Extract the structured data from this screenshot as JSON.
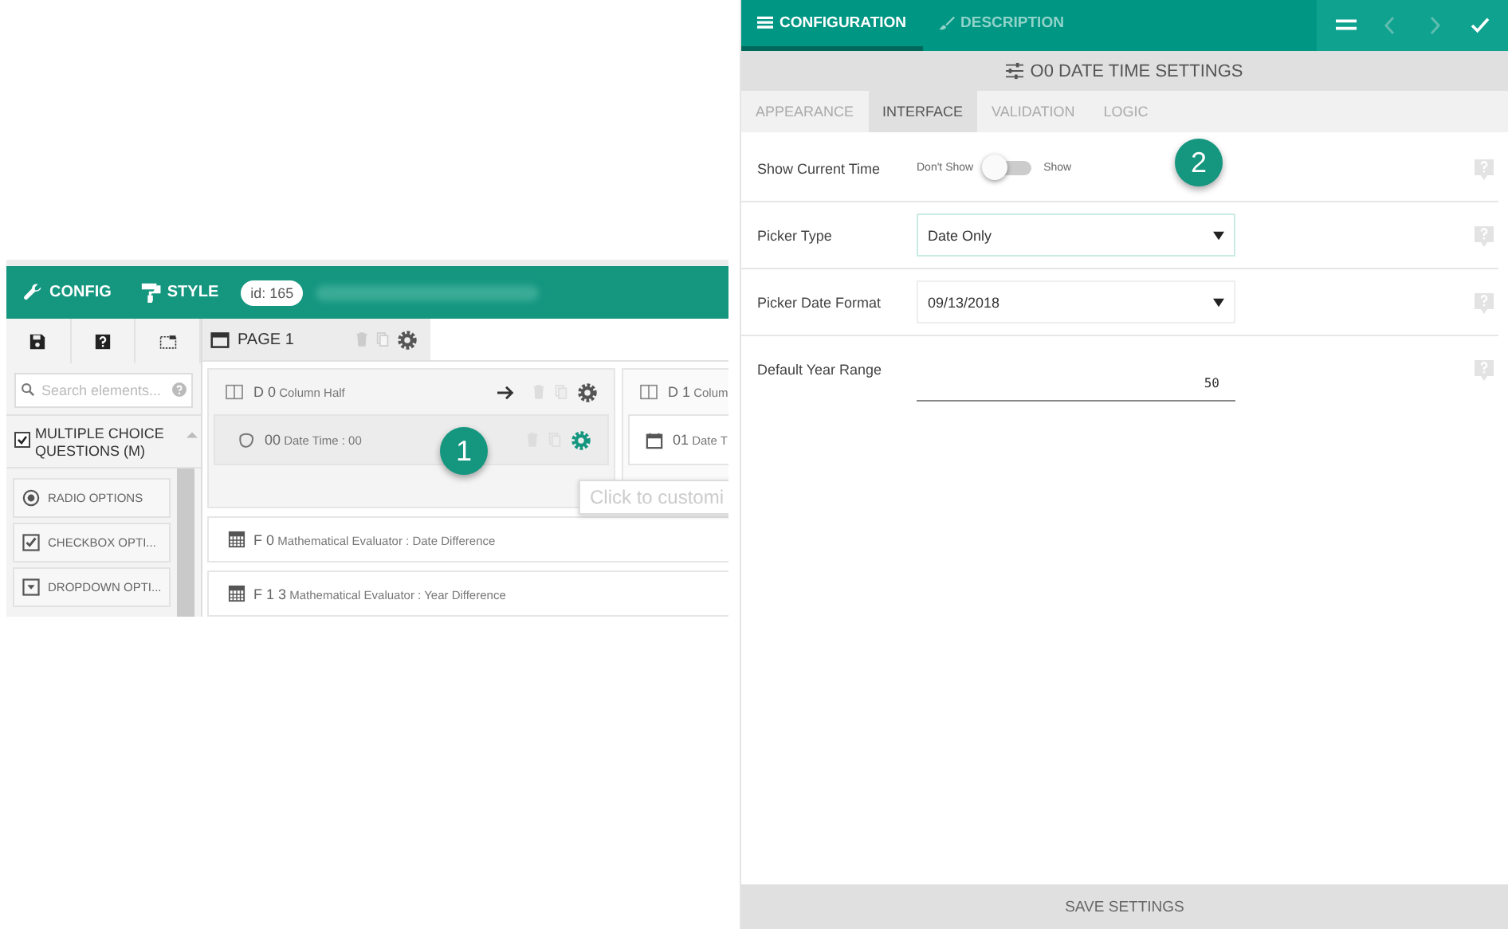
{
  "form_editor": {
    "topbar": {
      "items": [
        {
          "label": "CONFIG",
          "kind": "wrench"
        },
        {
          "label": "STYLE",
          "kind": "roller"
        }
      ],
      "id_badge": "id: 165"
    },
    "sidebar": {
      "search": {
        "placeholder": "Search elements..."
      },
      "category": {
        "label": "MULTIPLE CHOICE QUESTIONS (M)",
        "checked": true
      },
      "elements": [
        {
          "label": "RADIO OPTIONS",
          "kind": "radio"
        },
        {
          "label": "CHECKBOX OPTI...",
          "kind": "checkbox"
        },
        {
          "label": "DROPDOWN OPTI...",
          "kind": "dropdown"
        }
      ]
    },
    "page_tab": {
      "label": "PAGE 1"
    },
    "columns": [
      {
        "code": "D 0",
        "label": "Column Half",
        "field": {
          "code": "00",
          "label": "Date Time : 00",
          "kind": "datetime"
        }
      },
      {
        "code": "D 1",
        "label": "Colum",
        "field": {
          "code": "01",
          "label": "Date T",
          "kind": "calendar"
        }
      }
    ],
    "tooltip": "Click to customi",
    "formulas": [
      {
        "code": "F 0",
        "label": "Mathematical Evaluator : Date Difference"
      },
      {
        "code": "F 1 3",
        "label": "Mathematical Evaluator : Year Difference"
      }
    ],
    "callout": "1"
  },
  "settings_panel": {
    "tabs": [
      {
        "label": "CONFIGURATION",
        "selected": true,
        "kind": "config"
      },
      {
        "label": "DESCRIPTION",
        "selected": false,
        "kind": "description"
      }
    ],
    "title": "O0 DATE TIME SETTINGS",
    "subtabs": [
      {
        "label": "APPEARANCE",
        "selected": false
      },
      {
        "label": "INTERFACE",
        "selected": true
      },
      {
        "label": "VALIDATION",
        "selected": false
      },
      {
        "label": "LOGIC",
        "selected": false
      }
    ],
    "rows": [
      {
        "kind": "toggle",
        "label": "Show Current Time",
        "off_label": "Don't Show",
        "on_label": "Show",
        "on": false
      },
      {
        "kind": "select",
        "label": "Picker Type",
        "value": "Date Only",
        "focused": true
      },
      {
        "kind": "select",
        "label": "Picker Date Format",
        "value": "09/13/2018",
        "focused": false
      },
      {
        "kind": "text",
        "label": "Default Year Range",
        "value": "50"
      }
    ],
    "callout": "2",
    "save_button": "SAVE SETTINGS"
  }
}
